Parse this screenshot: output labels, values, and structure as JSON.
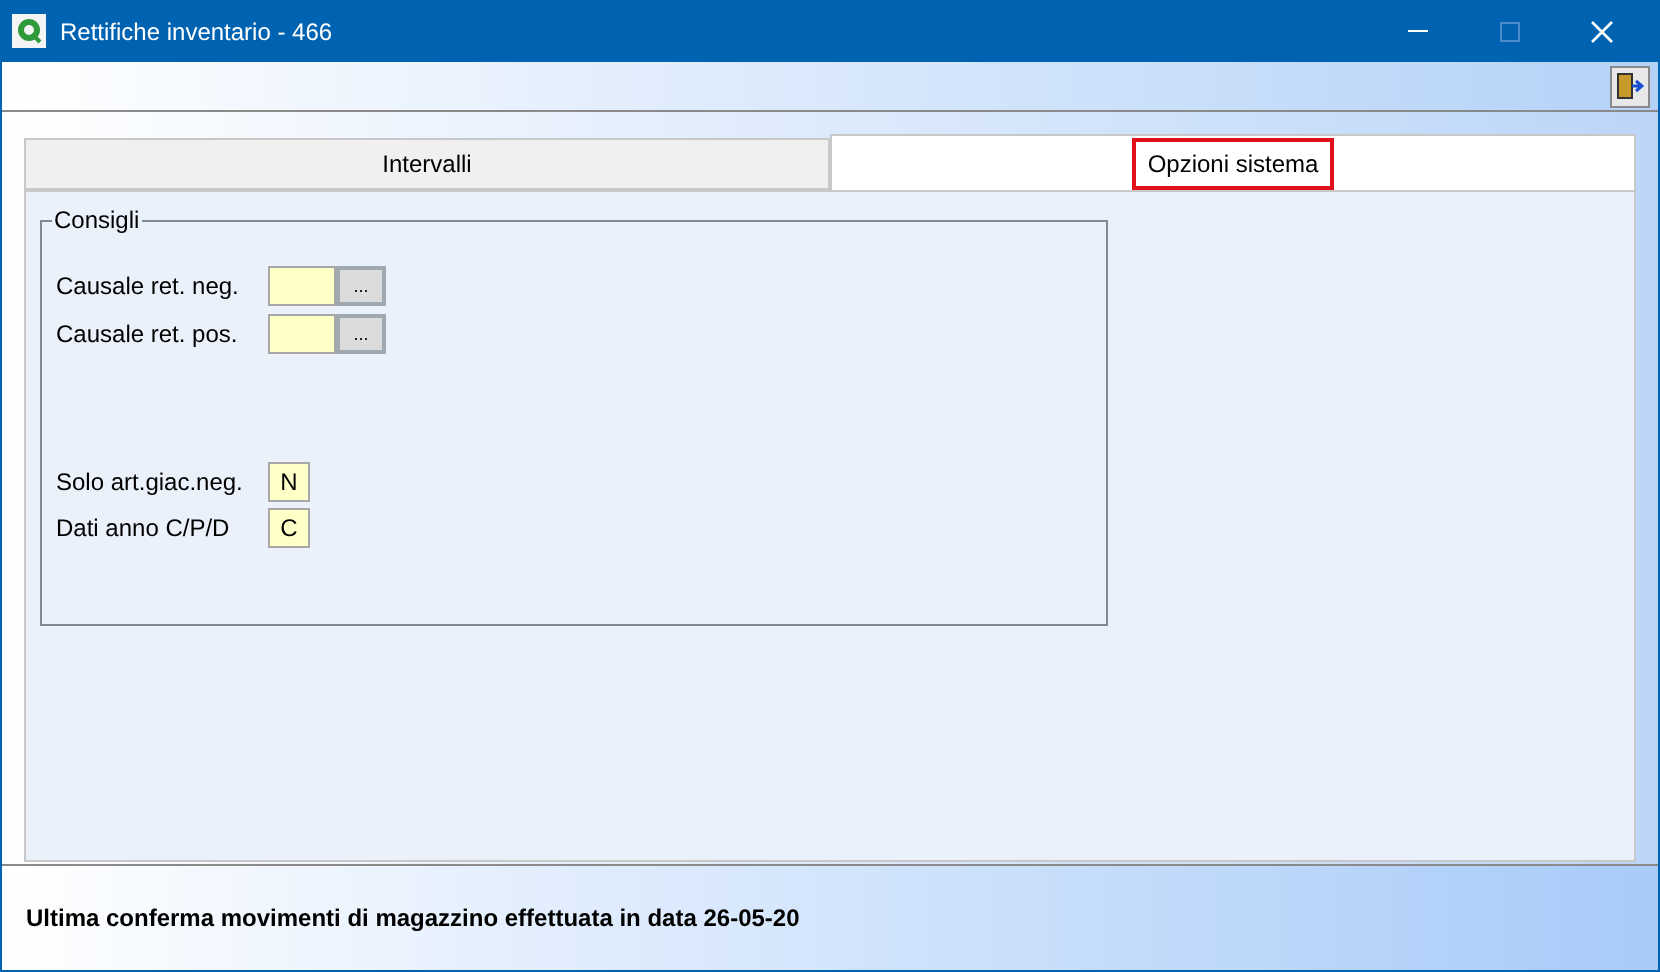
{
  "window": {
    "title": "Rettifiche inventario - 466"
  },
  "tabs": [
    {
      "label": "Intervalli",
      "selected": false,
      "highlighted": false
    },
    {
      "label": "Opzioni sistema",
      "selected": true,
      "highlighted": true
    }
  ],
  "group": {
    "title": "Consigli",
    "rows": [
      {
        "kind": "lookup",
        "label": "Causale ret. neg.",
        "button": "..."
      },
      {
        "kind": "lookup",
        "label": "Causale ret. pos.",
        "button": "..."
      },
      {
        "kind": "spacer"
      },
      {
        "kind": "flag",
        "label": "Solo art.giac.neg.",
        "value": "N"
      },
      {
        "kind": "flag",
        "label": "Dati anno C/P/D",
        "value": "C"
      }
    ]
  },
  "status_bar": {
    "text": "Ultima conferma movimenti di magazzino effettuata in data 26-05-20"
  }
}
